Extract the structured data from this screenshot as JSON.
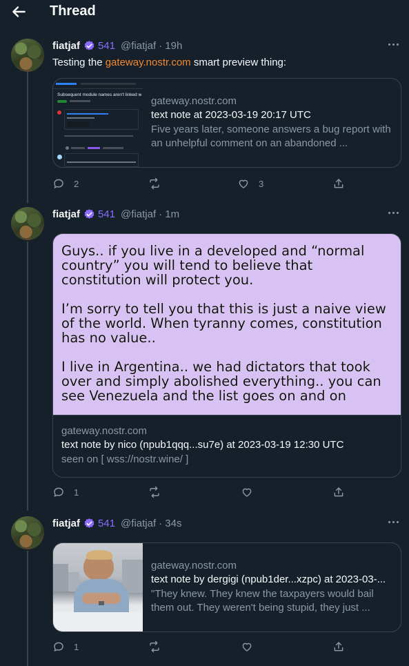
{
  "header": {
    "title": "Thread"
  },
  "posts": [
    {
      "author": "fiatjaf",
      "score": "541",
      "handle": "@fiatjaf",
      "time": "· 19h",
      "text_before": "Testing the ",
      "text_link": "gateway.nostr.com",
      "text_after": " smart preview thing:",
      "card": {
        "domain": "gateway.nostr.com",
        "title": "text note at 2023-03-19 20:17 UTC",
        "description": "Five years later, someone answers a bug report with an unhelpful comment on an abandoned ...",
        "thumb_heading": "Subsequent module names aren't linked within"
      },
      "stats": {
        "replies": "2",
        "reposts": "",
        "likes": "3"
      }
    },
    {
      "author": "fiatjaf",
      "score": "541",
      "handle": "@fiatjaf",
      "time": "· 1m",
      "card": {
        "image_text": "Guys.. if you live in a developed and “normal country” you will tend to believe that constitution will protect you.\n\nI’m sorry to tell you that this is just a naive view of the world. When tyranny comes, constitution has no value..\n\nI live in Argentina.. we had dictators that took over and simply abolished everything.. you can see Venezuela and the list goes on and on",
        "domain": "gateway.nostr.com",
        "title": "text note by nico (npub1qqq...su7e) at 2023-03-19 12:30 UTC",
        "seen_on": "seen on [ wss://nostr.wine/ ]"
      },
      "stats": {
        "replies": "1",
        "reposts": "",
        "likes": ""
      }
    },
    {
      "author": "fiatjaf",
      "score": "541",
      "handle": "@fiatjaf",
      "time": "· 34s",
      "card": {
        "domain": "gateway.nostr.com",
        "title": "text note by dergigi (npub1der...xzpc) at 2023-03-...",
        "description": "\"They knew. They knew the taxpayers would bail them out. They weren't being stupid, they just ..."
      },
      "stats": {
        "replies": "1",
        "reposts": "",
        "likes": ""
      }
    }
  ],
  "colors": {
    "background": "#15202b",
    "link": "#f4882c",
    "score": "#8d6bff",
    "muted": "#8b98a5",
    "border": "#38444d"
  }
}
